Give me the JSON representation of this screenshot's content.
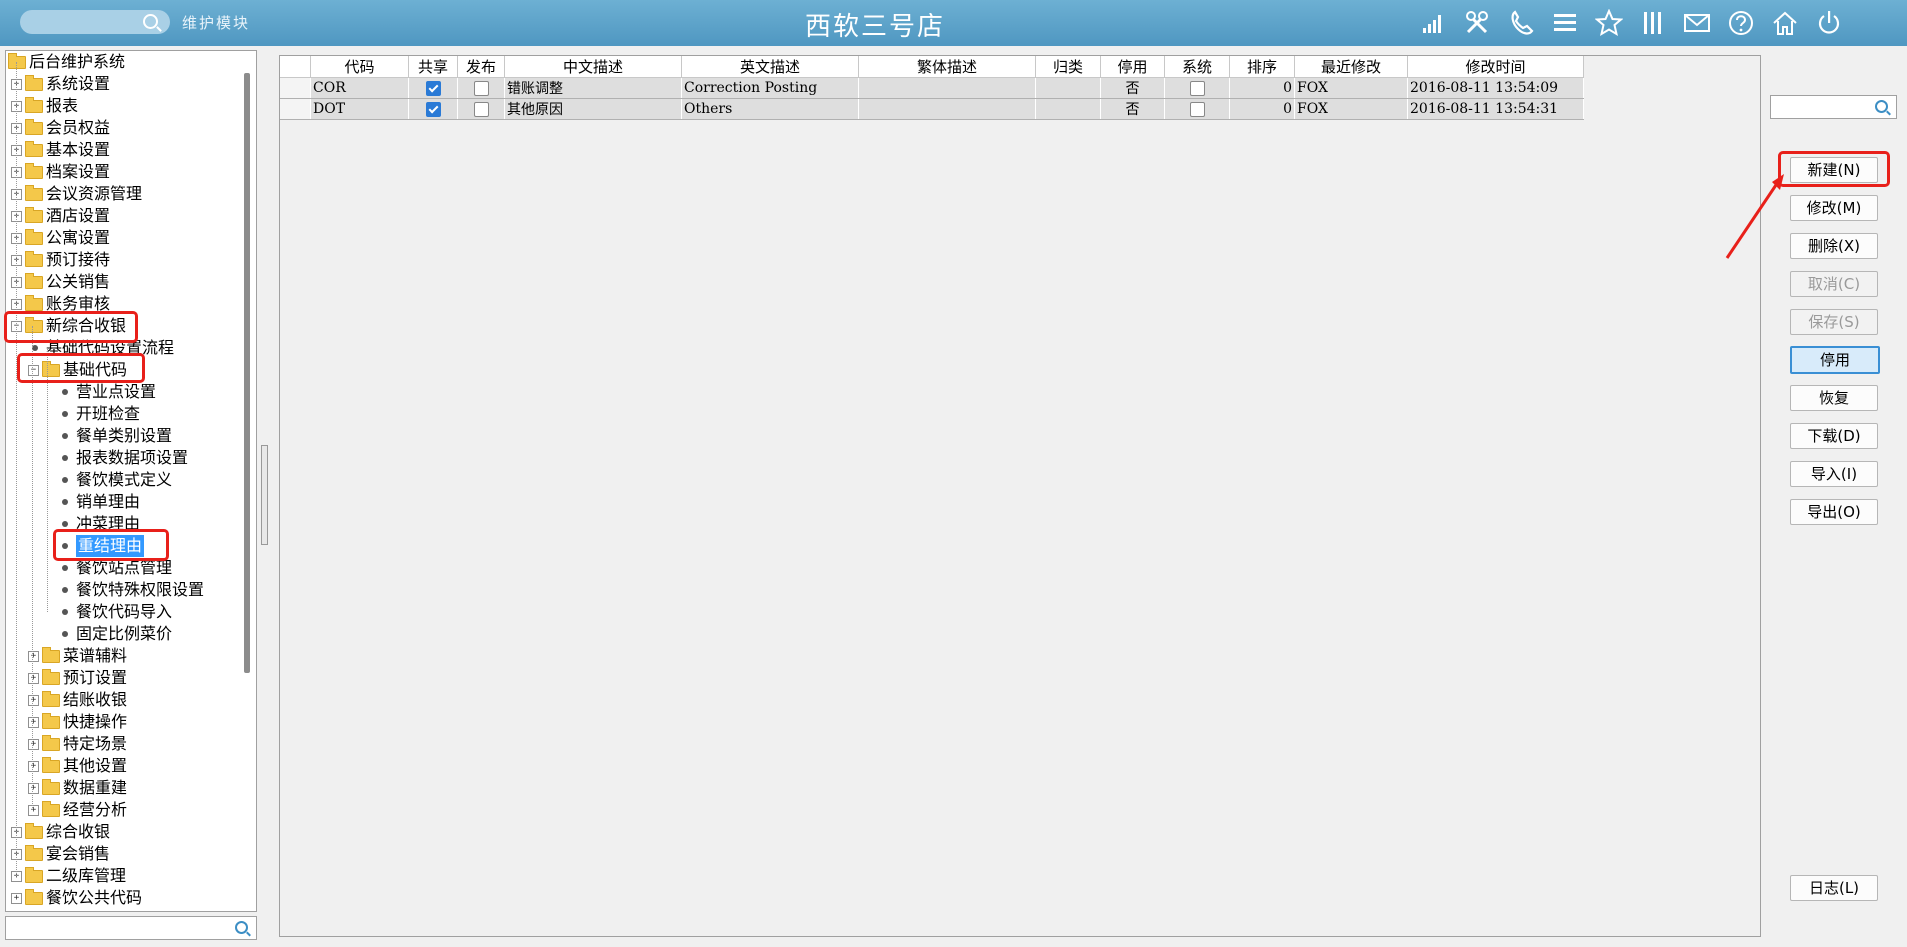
{
  "header": {
    "search_placeholder": "",
    "module_label": "维护模块",
    "title": "西软三号店",
    "icons": [
      "signal-icon",
      "tools-icon",
      "phone-icon",
      "menu-icon",
      "star-icon",
      "columns-icon",
      "mail-icon",
      "help-icon",
      "home-icon",
      "power-icon"
    ]
  },
  "tree": {
    "root": "后台维护系统",
    "items": [
      "系统设置",
      "报表",
      "会员权益",
      "基本设置",
      "档案设置",
      "会议资源管理",
      "酒店设置",
      "公寓设置",
      "预订接待",
      "公关销售",
      "账务审核",
      "新综合收银",
      "基础代码设置流程",
      "基础代码",
      "营业点设置",
      "开班检查",
      "餐单类别设置",
      "报表数据项设置",
      "餐饮模式定义",
      "销单理由",
      "冲菜理由",
      "重结理由",
      "餐饮站点管理",
      "餐饮特殊权限设置",
      "餐饮代码导入",
      "固定比例菜价",
      "菜谱辅料",
      "预订设置",
      "结账收银",
      "快捷操作",
      "特定场景",
      "其他设置",
      "数据重建",
      "经营分析",
      "综合收银",
      "宴会销售",
      "二级库管理",
      "餐饮公共代码"
    ]
  },
  "grid": {
    "columns": [
      "代码",
      "共享",
      "发布",
      "中文描述",
      "英文描述",
      "繁体描述",
      "归类",
      "停用",
      "系统",
      "排序",
      "最近修改",
      "修改时间"
    ],
    "rows": [
      {
        "code": "COR",
        "shared": true,
        "publish": false,
        "cn": "错账调整",
        "en": "Correction Posting",
        "tw": "",
        "cat": "",
        "disabled": "否",
        "system": false,
        "order": "0",
        "modifier": "FOX",
        "time": "2016-08-11 13:54:09"
      },
      {
        "code": "DOT",
        "shared": true,
        "publish": false,
        "cn": "其他原因",
        "en": "Others",
        "tw": "",
        "cat": "",
        "disabled": "否",
        "system": false,
        "order": "0",
        "modifier": "FOX",
        "time": "2016-08-11 13:54:31"
      }
    ]
  },
  "buttons": {
    "new": "新建(N)",
    "modify": "修改(M)",
    "delete": "删除(X)",
    "cancel": "取消(C)",
    "save": "保存(S)",
    "disable": "停用",
    "restore": "恢复",
    "download": "下载(D)",
    "import": "导入(I)",
    "export": "导出(O)",
    "log": "日志(L)"
  },
  "colors": {
    "header_bg": "#5da4cb",
    "selection": "#3399ff",
    "annotation": "#e8201a"
  }
}
